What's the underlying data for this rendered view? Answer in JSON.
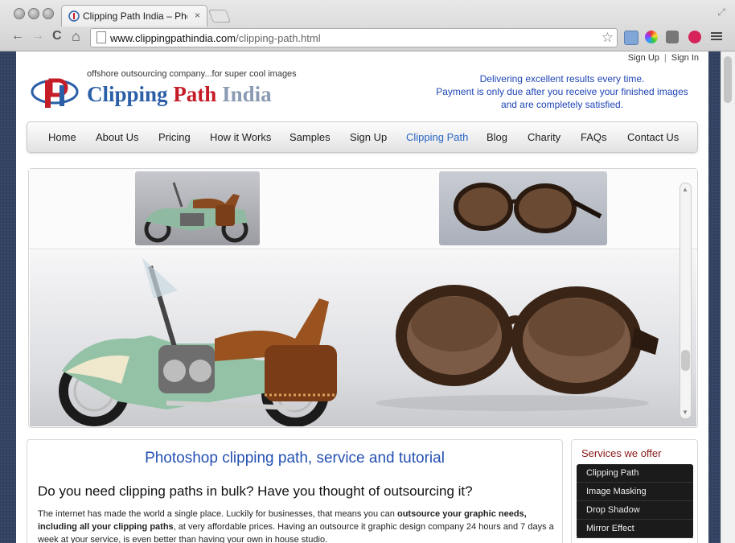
{
  "browser": {
    "tab_title": "Clipping Path India – Photosh",
    "tab_close": "×",
    "url_host": "www.clippingpathindia.com",
    "url_path": "/clipping-path.html",
    "back": "←",
    "forward": "→",
    "reload": "C",
    "home": "⌂",
    "star": "☆",
    "restore": "⤢"
  },
  "header": {
    "sign_up": "Sign Up",
    "separator": "|",
    "sign_in": "Sign In",
    "logo_tagline": "offshore outsourcing company...for super cool images",
    "logo_word1": "Clipping",
    "logo_word2": "Path",
    "logo_word3": "India",
    "tagline_1": "Delivering excellent results every time.",
    "tagline_2": "Payment is only due after you receive your finished images",
    "tagline_3": "and are completely satisfied."
  },
  "nav": {
    "items": [
      {
        "label": "Home"
      },
      {
        "label": "About Us"
      },
      {
        "label": "Pricing"
      },
      {
        "label": "How it Works"
      },
      {
        "label": "Samples"
      },
      {
        "label": "Sign Up"
      },
      {
        "label": "Clipping Path"
      },
      {
        "label": "Blog"
      },
      {
        "label": "Charity"
      },
      {
        "label": "FAQs"
      },
      {
        "label": "Contact Us"
      }
    ],
    "active_index": 6
  },
  "content": {
    "heading": "Photoshop clipping path, service and tutorial",
    "subheading": "Do you need clipping paths in bulk? Have you thought of outsourcing it?",
    "p_text1": "The internet has made the world a single place. Luckily for businesses, that means you can ",
    "p_bold": "outsource your graphic needs, including all your clipping paths",
    "p_text2": ", at very affordable prices. Having an outsource it graphic design company 24 hours and 7 days a week at your service, is even better than having your own in house studio."
  },
  "services": {
    "heading": "Services we offer",
    "items": [
      {
        "label": "Clipping Path"
      },
      {
        "label": "Image Masking"
      },
      {
        "label": "Drop Shadow"
      },
      {
        "label": "Mirror Effect"
      }
    ]
  },
  "colors": {
    "link_blue": "#2a66c4",
    "tagline_blue": "#1f45b5",
    "services_red": "#8a1818",
    "menu_dark": "#1b1b1b"
  }
}
